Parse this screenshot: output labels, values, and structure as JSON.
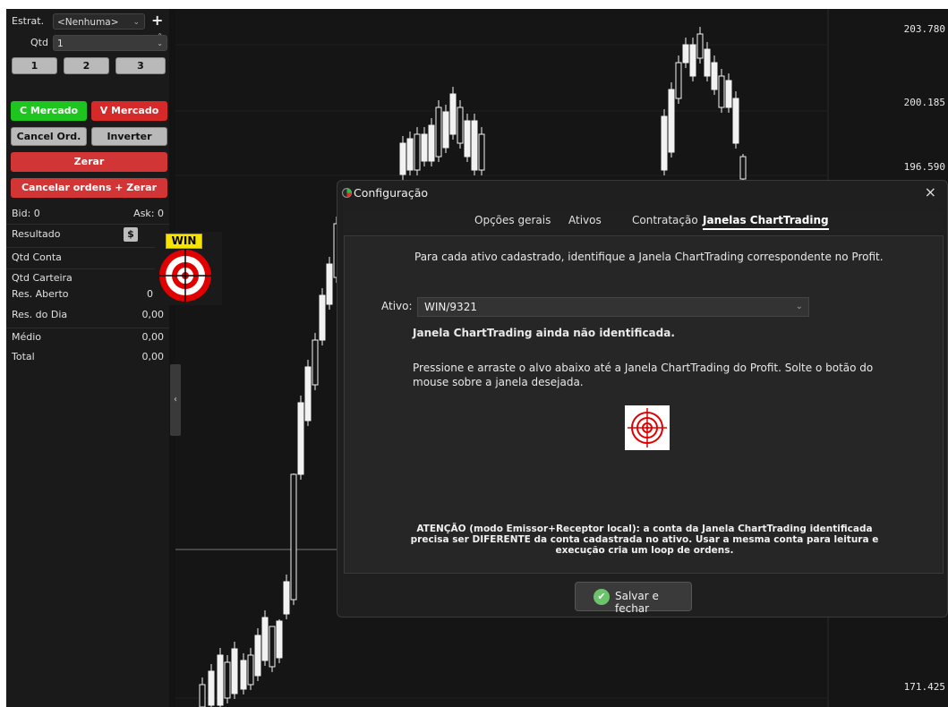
{
  "panel": {
    "strategy_label": "Estrat.",
    "strategy_value": "<Nenhuma>",
    "add_icon": "plus-icon",
    "qty_label": "Qtd",
    "qty_value": "1",
    "quick_qty": [
      "1",
      "2",
      "3"
    ],
    "buy_market": "C Mercado",
    "sell_market": "V Mercado",
    "cancel_orders": "Cancel Ord.",
    "invert": "Inverter",
    "zero": "Zerar",
    "cancel_and_zero": "Cancelar ordens + Zerar",
    "bid": "Bid: 0",
    "ask": "Ask: 0",
    "result_label": "Resultado",
    "currency_btn": "$",
    "rows": [
      {
        "label": "Qtd Conta",
        "value": ""
      },
      {
        "label": "Qtd Carteira",
        "value": ""
      },
      {
        "label": "Res. Aberto",
        "value": "0"
      },
      {
        "label": "Res. do Dia",
        "value": "0,00"
      },
      {
        "label": "Médio",
        "value": "0,00"
      },
      {
        "label": "Total",
        "value": "0,00"
      }
    ],
    "collapse_icon": "‹"
  },
  "win_target": {
    "label": "WIN"
  },
  "chart": {
    "price_labels": [
      "203.780",
      "200.185",
      "196.590",
      "171.425"
    ],
    "colors": {
      "candle": "#f2f2f2",
      "grid": "#2a2a2a",
      "crosshair": "#777777"
    }
  },
  "dialog": {
    "title": "Configuração",
    "tabs": [
      "Opções gerais",
      "Ativos",
      "Contratação",
      "Janelas ChartTrading"
    ],
    "active_tab": "Janelas ChartTrading",
    "intro": "Para cada ativo cadastrado, identifique a Janela ChartTrading correspondente no Profit.",
    "ativo_label": "Ativo:",
    "ativo_value": "WIN/9321",
    "status": "Janela ChartTrading ainda não identificada.",
    "instruction_line1": "Pressione e arraste o alvo abaixo até a Janela ChartTrading do Profit. Solte o botão do",
    "instruction_line2": "mouse sobre a janela desejada.",
    "warning_line1": "ATENÇÃO (modo Emissor+Receptor local): a conta da Janela ChartTrading identificada",
    "warning_line2": "precisa ser DIFERENTE da conta cadastrada no ativo. Usar a mesma conta para leitura e",
    "warning_line3": "execução cria um loop de ordens.",
    "save_button": "Salvar e fechar",
    "close_icon": "×"
  }
}
